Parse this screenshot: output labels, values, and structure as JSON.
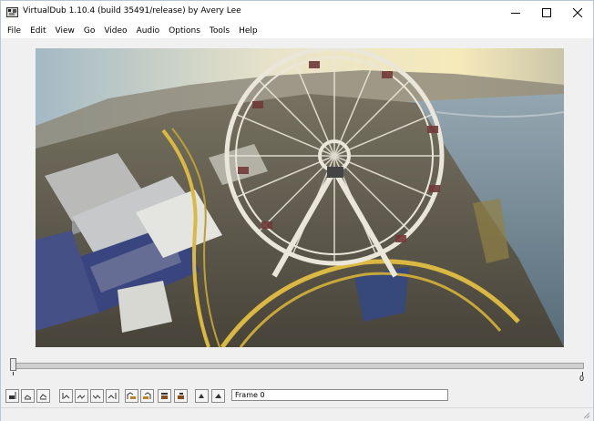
{
  "window": {
    "title": "VirtualDub 1.10.4 (build 35491/release) by Avery Lee",
    "controls": {
      "minimize": "minimize-icon",
      "maximize": "maximize-icon",
      "close": "close-icon"
    }
  },
  "menu": [
    "File",
    "Edit",
    "View",
    "Go",
    "Video",
    "Audio",
    "Options",
    "Tools",
    "Help"
  ],
  "timeline": {
    "position": 0,
    "end_label": "0"
  },
  "toolbar": {
    "buttons": [
      {
        "name": "stop-icon"
      },
      {
        "name": "play-input-icon"
      },
      {
        "name": "play-output-icon"
      },
      {
        "name": "go-start-icon"
      },
      {
        "name": "step-back-icon"
      },
      {
        "name": "step-forward-icon"
      },
      {
        "name": "go-end-icon"
      },
      {
        "name": "prev-keyframe-icon"
      },
      {
        "name": "next-keyframe-icon"
      },
      {
        "name": "scene-back-icon"
      },
      {
        "name": "scene-forward-icon"
      },
      {
        "name": "mark-in-icon"
      },
      {
        "name": "mark-out-icon"
      }
    ],
    "frame_label": "Frame 0"
  }
}
